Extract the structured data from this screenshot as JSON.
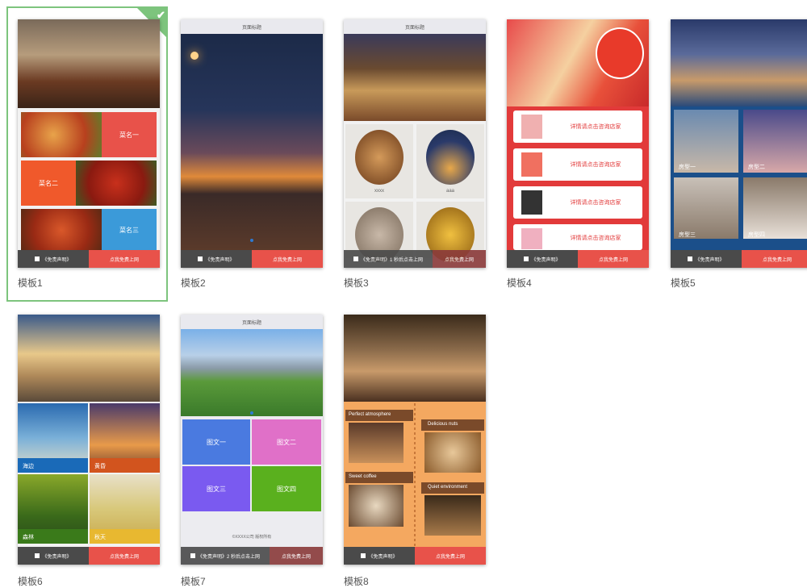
{
  "templates": [
    {
      "name": "模板1",
      "selected": true,
      "bar": {
        "left": "《免责声明》",
        "right": "点我免费上网"
      },
      "dishes": [
        "菜名一",
        "菜名二",
        "菜名三"
      ]
    },
    {
      "name": "模板2",
      "header": "页面标题",
      "bar": {
        "left": "《免责声明》",
        "right": "点我免费上网"
      }
    },
    {
      "name": "模板3",
      "header": "页面标题",
      "circles": [
        "xxxx",
        "aaa"
      ],
      "bar": {
        "left": "《免责声明》1 秒后点击上网",
        "right": "点我免费上网"
      }
    },
    {
      "name": "模板4",
      "items": [
        "详情请点击咨询店家",
        "详情请点击咨询店家",
        "详情请点击咨询店家",
        "详情请点击咨询店家"
      ],
      "bar": {
        "left": "《免责声明》",
        "right": "点我免费上网"
      }
    },
    {
      "name": "模板5",
      "rooms": [
        "房型一",
        "房型二",
        "房型三",
        "房型四"
      ],
      "bar": {
        "left": "《免责声明》",
        "right": "点我免费上网"
      }
    },
    {
      "name": "模板6",
      "scenes": [
        "海边",
        "黄昏",
        "森林",
        "秋天"
      ],
      "bar": {
        "left": "《免责声明》",
        "right": "点我免费上网"
      }
    },
    {
      "name": "模板7",
      "header": "页面标题",
      "tiles": [
        "图文一",
        "图文二",
        "图文三",
        "图文四"
      ],
      "footer_note": "©XXXX公司 版权所有",
      "bar": {
        "left": "《免责声明》2 秒后点击上网",
        "right": "点我免费上网"
      }
    },
    {
      "name": "模板8",
      "labels": [
        "Perfect atmosphere",
        "Delicious nuts",
        "Sweet coffee",
        "Quiet environment"
      ],
      "bar": {
        "left": "《免责声明》",
        "right": "点我免费上网"
      }
    }
  ]
}
